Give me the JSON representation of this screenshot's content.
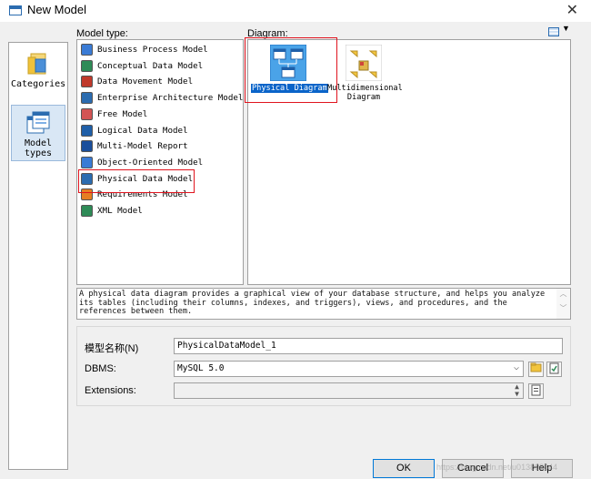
{
  "window": {
    "title": "New Model"
  },
  "categories": [
    {
      "label": "Categories",
      "icon": "folder-icon"
    },
    {
      "label": "Model types",
      "icon": "model-types-icon"
    }
  ],
  "model_type_label": "Model type:",
  "diagram_label": "Diagram:",
  "model_types": [
    {
      "label": "Business Process Model",
      "icon": "business-process-icon",
      "color": "#3a7bd5"
    },
    {
      "label": "Conceptual Data Model",
      "icon": "conceptual-data-icon",
      "color": "#2e8b57"
    },
    {
      "label": "Data Movement Model",
      "icon": "data-movement-icon",
      "color": "#c0392b"
    },
    {
      "label": "Enterprise Architecture Model",
      "icon": "enterprise-architecture-icon",
      "color": "#2b6cb0"
    },
    {
      "label": "Free Model",
      "icon": "free-model-icon",
      "color": "#d35454"
    },
    {
      "label": "Logical Data Model",
      "icon": "logical-data-icon",
      "color": "#1f5fa8"
    },
    {
      "label": "Multi-Model Report",
      "icon": "multi-model-report-icon",
      "color": "#1b4f9c"
    },
    {
      "label": "Object-Oriented Model",
      "icon": "object-oriented-icon",
      "color": "#3a7bd5"
    },
    {
      "label": "Physical Data Model",
      "icon": "physical-data-icon",
      "color": "#2b6cb0"
    },
    {
      "label": "Requirements Model",
      "icon": "requirements-icon",
      "color": "#e67e22"
    },
    {
      "label": "XML Model",
      "icon": "xml-model-icon",
      "color": "#2e8b57"
    }
  ],
  "diagrams": [
    {
      "label": "Physical Diagram",
      "icon": "physical-diagram-icon",
      "selected": true
    },
    {
      "label": "Multidimensional Diagram",
      "icon": "multidimensional-diagram-icon",
      "selected": false
    }
  ],
  "description": "A physical data diagram provides a graphical view of your database structure, and helps you analyze its tables (including their columns, indexes, and triggers), views, and procedures, and the references between them.",
  "form": {
    "name_label": "模型名称(N)",
    "name_value": "PhysicalDataModel_1",
    "dbms_label": "DBMS:",
    "dbms_value": "MySQL 5.0",
    "extensions_label": "Extensions:",
    "extensions_value": ""
  },
  "buttons": {
    "ok": "OK",
    "cancel": "Cancel",
    "help": "Help"
  },
  "watermark": "https://blog.csdn.net/u013898644"
}
